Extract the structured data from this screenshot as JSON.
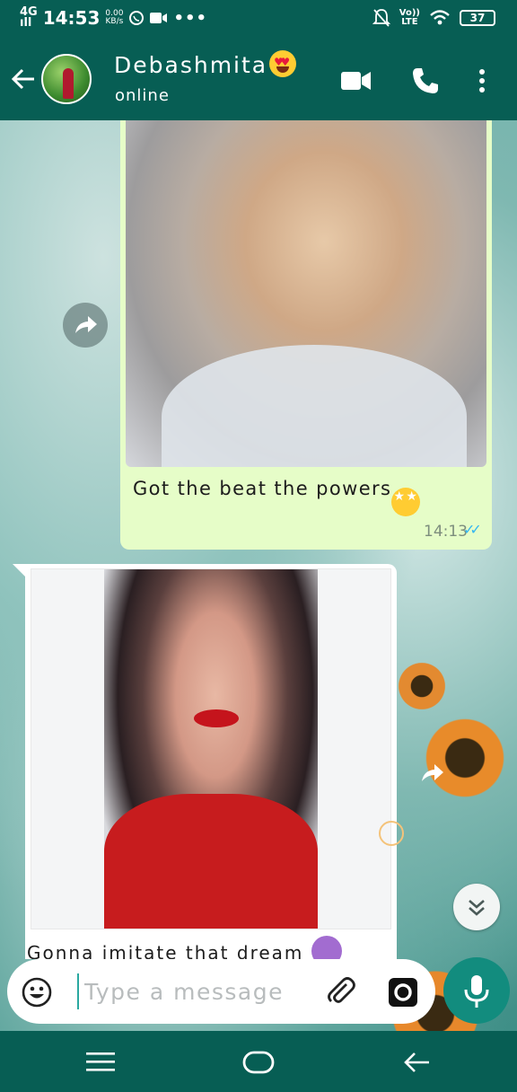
{
  "status_bar": {
    "network": "4G",
    "signal": "ıll",
    "time": "14:53",
    "data_speed_value": "0.00",
    "data_speed_unit": "KB/s",
    "more": "•••",
    "volte_top": "Vo))",
    "volte_bottom": "LTE",
    "battery": "37"
  },
  "header": {
    "contact_name": "Debashmita",
    "contact_status": "online"
  },
  "messages": [
    {
      "direction": "outgoing",
      "type": "image",
      "caption": "Got the beat the powers",
      "time": "14:13",
      "read_receipt": "✓✓"
    },
    {
      "direction": "incoming",
      "type": "image",
      "caption": "Gonna imitate that dream"
    }
  ],
  "composer": {
    "placeholder": "Type a message"
  },
  "colors": {
    "header_bg": "#075e54",
    "outgoing_bubble": "#e6fdc8",
    "mic_button": "#128c7e",
    "read_tick": "#34b7f1"
  },
  "icons": [
    "back-arrow-icon",
    "video-call-icon",
    "voice-call-icon",
    "more-vert-icon",
    "forward-icon",
    "chevron-double-down-icon",
    "emoji-icon",
    "attach-icon",
    "camera-icon",
    "mic-icon",
    "menu-icon",
    "home-icon",
    "nav-back-icon"
  ]
}
